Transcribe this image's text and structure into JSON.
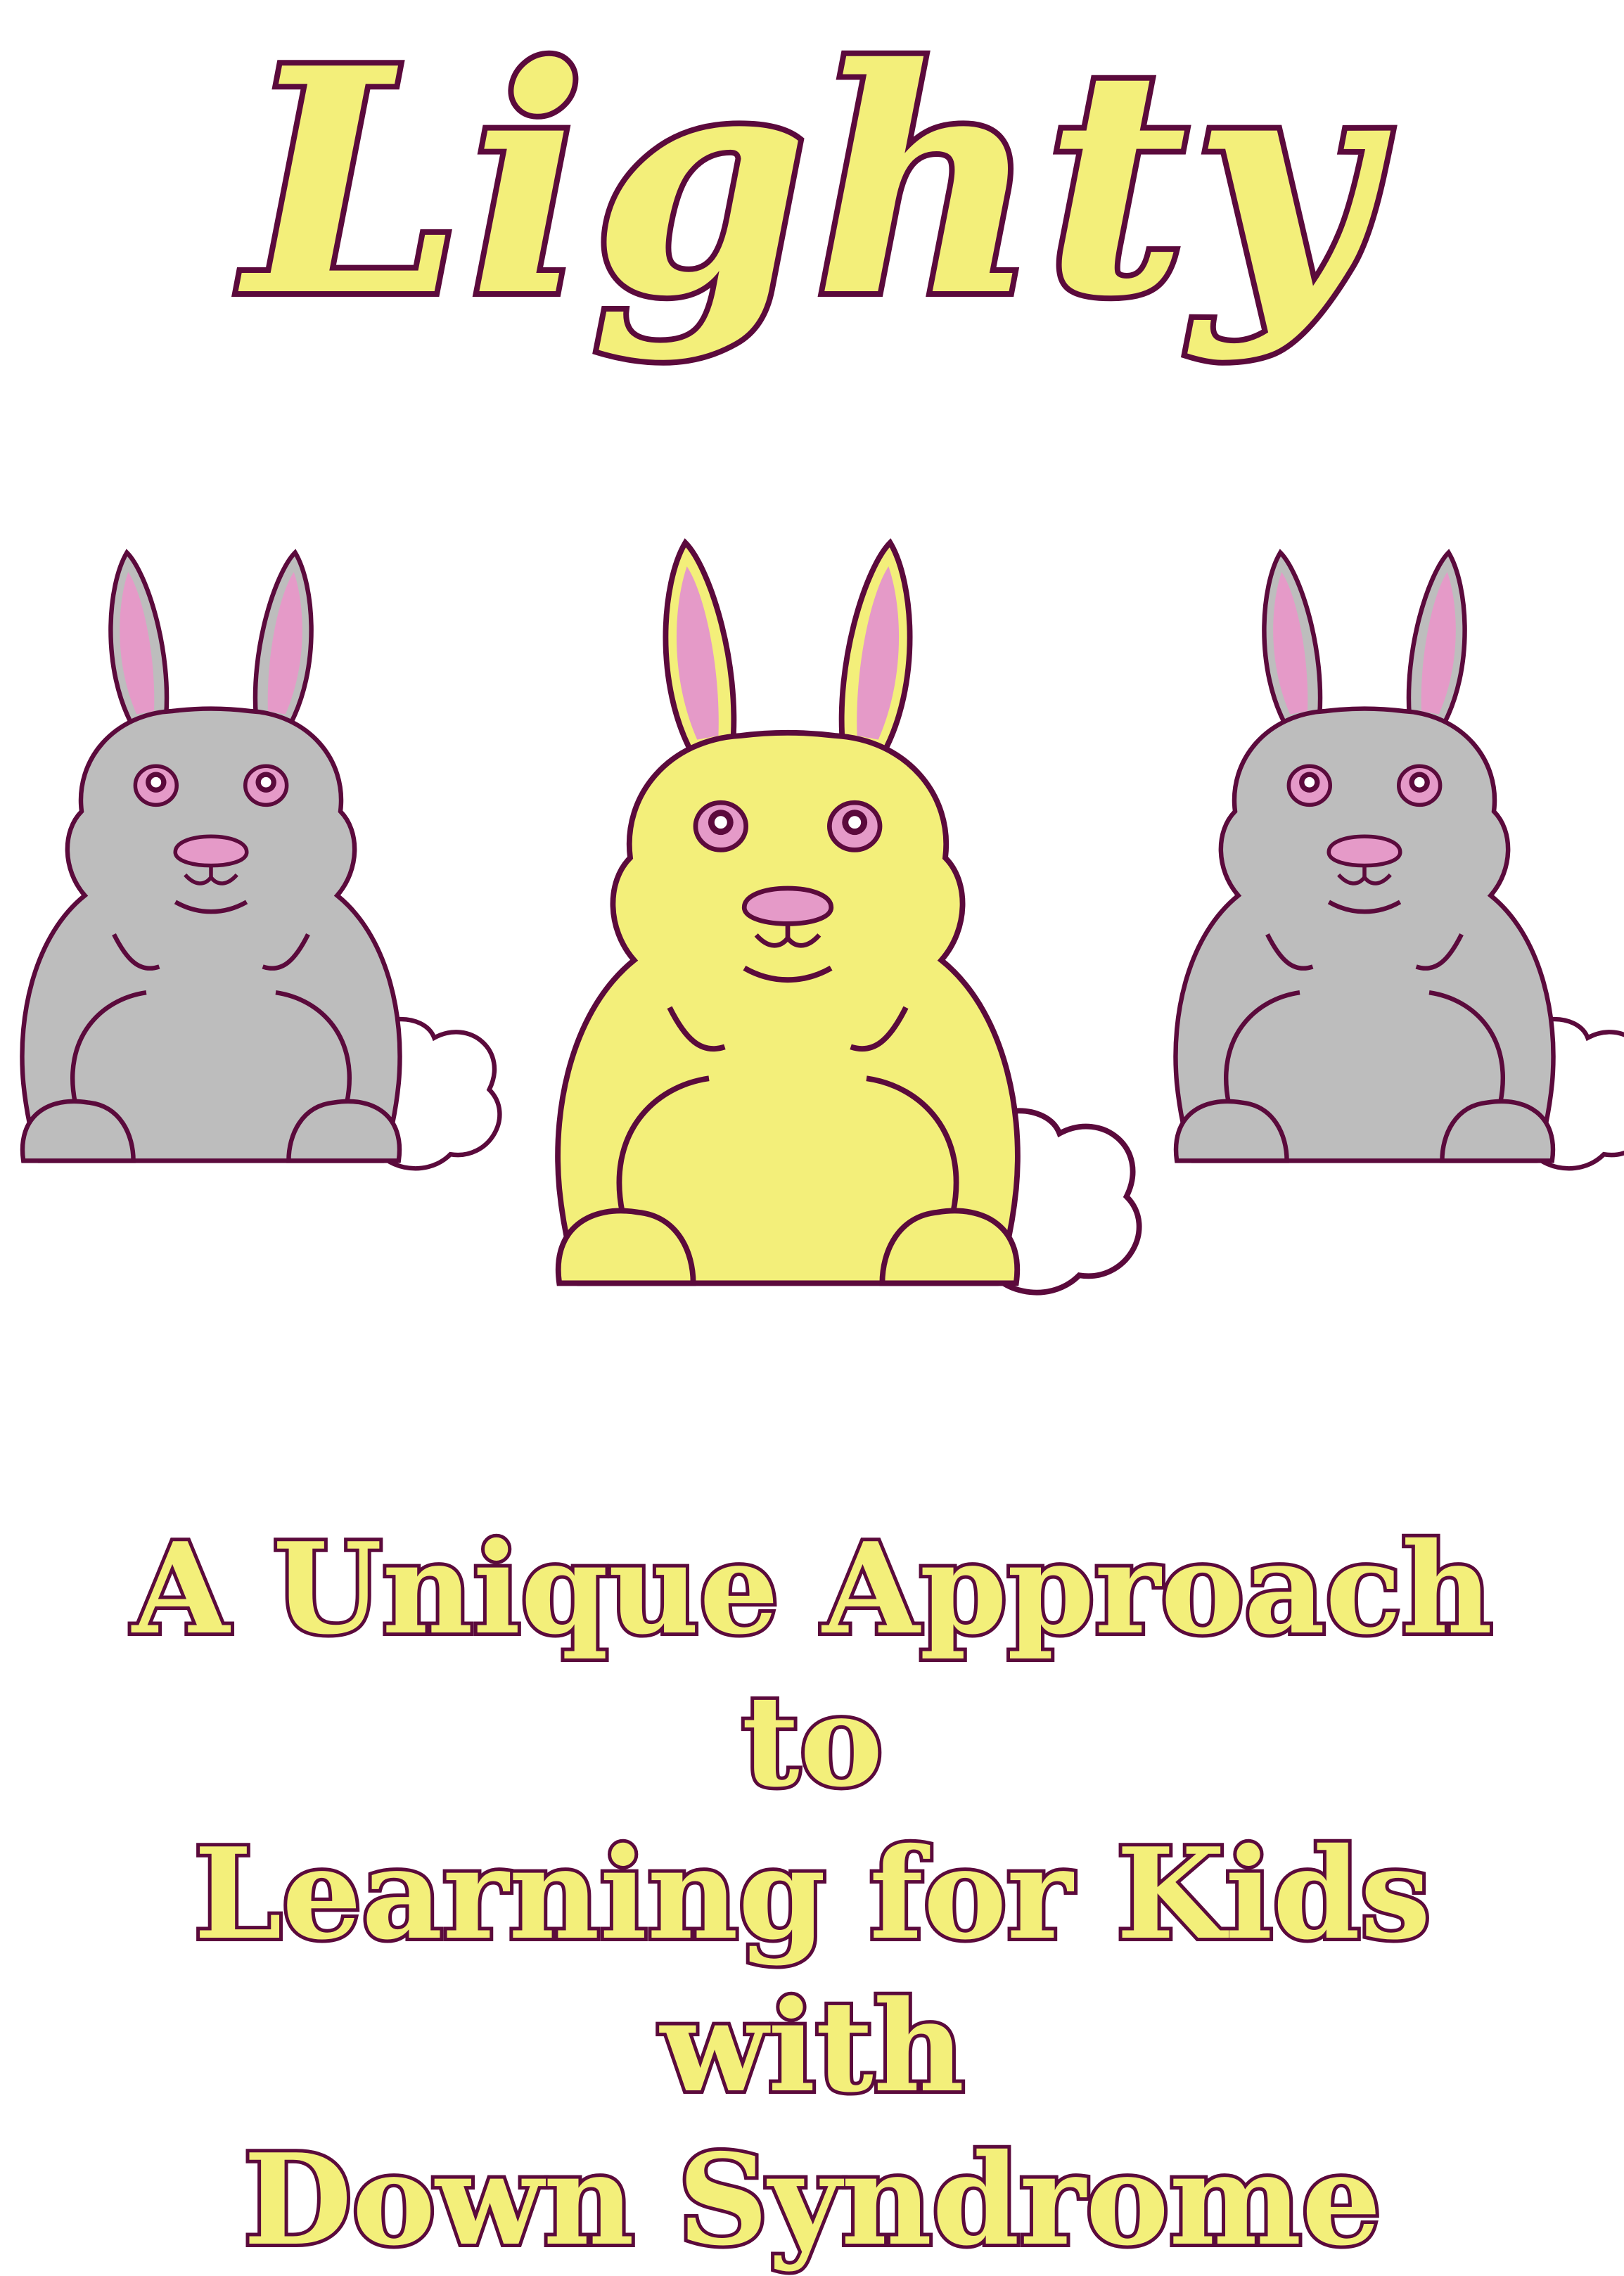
{
  "colors": {
    "outline": "#5b0a3c",
    "title_fill": "#f3ef7a",
    "gray_body": "#bdbdbd",
    "yellow_body": "#f3ef7a",
    "ear_inner": "#e59ac8",
    "tail": "#ffffff"
  },
  "title": "Lighty",
  "subtitle": {
    "line1": "A Unique Approach to",
    "line2": "Learning for Kids with",
    "line3": "Down Syndrome"
  },
  "illustration": {
    "bunnies": [
      {
        "name": "left-bunny",
        "color": "gray"
      },
      {
        "name": "center-bunny",
        "color": "yellow"
      },
      {
        "name": "right-bunny",
        "color": "gray"
      }
    ]
  }
}
